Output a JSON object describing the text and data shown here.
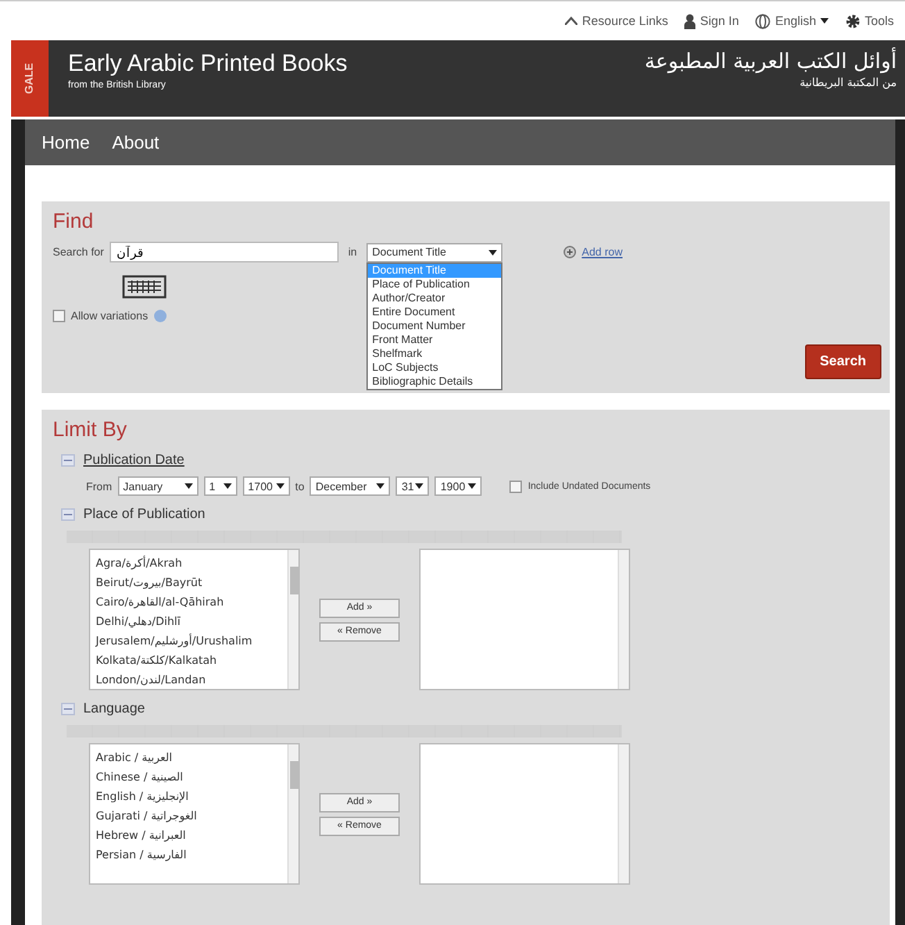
{
  "top_links": [
    {
      "kind": "up",
      "label": "Resource Links"
    },
    {
      "kind": "person",
      "label": "Sign In"
    },
    {
      "kind": "globe",
      "label": "English",
      "dropdown": true
    },
    {
      "kind": "gear",
      "label": "Tools"
    }
  ],
  "header": {
    "brand": "GALE",
    "title": "Early Arabic Printed Books",
    "subtitle": "from the British Library",
    "title_ar": "أوائل الكتب العربية المطبوعة",
    "subtitle_ar": "من المكتبة البريطانية"
  },
  "nav": [
    {
      "label": "Home"
    },
    {
      "label": "About"
    }
  ],
  "find": {
    "title": "Find",
    "search_label": "Search for",
    "search_value": "قرآن",
    "in_label": "in",
    "field": "Document Title",
    "options": [
      {
        "label": "Document Title",
        "selected": true
      },
      {
        "label": "Place of Publication",
        "selected": false
      },
      {
        "label": "Author/Creator",
        "selected": false
      },
      {
        "label": "Entire Document",
        "selected": false
      },
      {
        "label": "Document Number",
        "selected": false
      },
      {
        "label": "Front Matter",
        "selected": false
      },
      {
        "label": "Shelfmark",
        "selected": false
      },
      {
        "label": "LoC Subjects",
        "selected": false
      },
      {
        "label": "Bibliographic Details",
        "selected": false
      }
    ],
    "add_row": "Add row",
    "allow_variations": {
      "label": "Allow variations",
      "checked": false
    },
    "search_button": "Search"
  },
  "limit_by": {
    "title": "Limit By",
    "publication_date": {
      "title": "Publication Date",
      "from_label": "From",
      "from": [
        "January",
        "1",
        "1700"
      ],
      "to_label": "to",
      "to": [
        "December",
        "31",
        "1900"
      ],
      "include_undated": {
        "label": "Include Undated Documents",
        "checked": false
      }
    },
    "lists": [
      {
        "title": "Place of Publication",
        "items": [
          "Agra/أكرة/Akrah",
          "Beirut/بيروت/Bayrūt",
          "Cairo/القاهرة/al-Qāhirah",
          "Delhi/دهلي/Dihlī",
          "Jerusalem/أورشليم/Urushalim",
          "Kolkata/كلكتة/Kalkatah",
          "London/لندن/Landan"
        ],
        "add": "Add »",
        "remove": "« Remove"
      },
      {
        "title": "Language",
        "items": [
          "Arabic / العربية",
          "Chinese / الصينية",
          "English / الإنجليزية",
          "Gujarati / الغوجراتية",
          "Hebrew / العبرانية",
          "Persian / الفارسية"
        ],
        "add": "Add »",
        "remove": "« Remove"
      }
    ]
  }
}
